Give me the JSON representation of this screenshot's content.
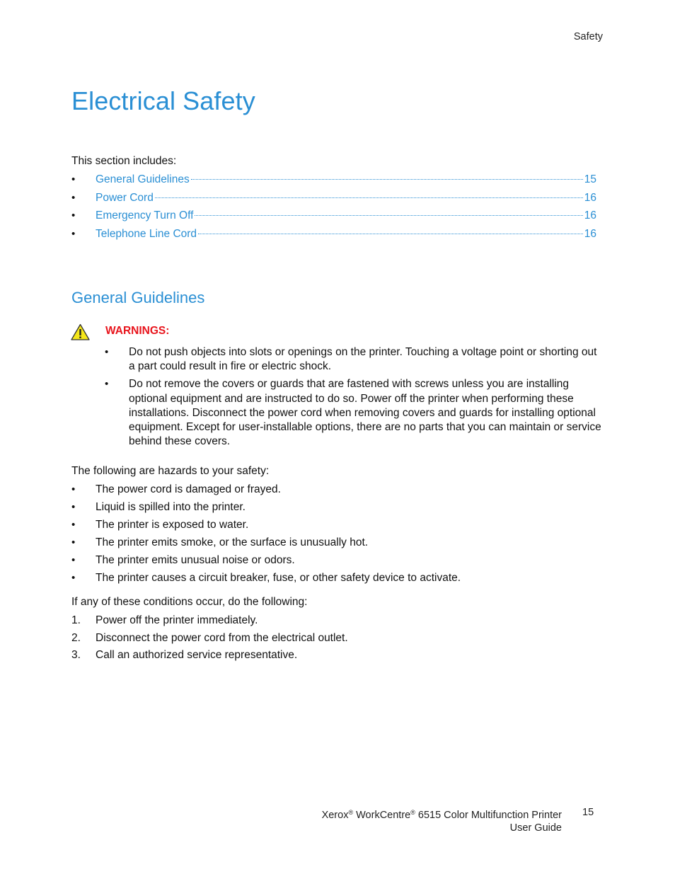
{
  "header": {
    "running_title": "Safety"
  },
  "title": "Electrical Safety",
  "intro": "This section includes:",
  "toc": [
    {
      "label": "General Guidelines",
      "page": "15"
    },
    {
      "label": "Power Cord",
      "page": "16"
    },
    {
      "label": "Emergency Turn Off",
      "page": "16"
    },
    {
      "label": "Telephone Line Cord",
      "page": "16"
    }
  ],
  "section": {
    "heading": "General Guidelines",
    "warning_icon": "warning-triangle-icon",
    "warning_title": "WARNINGS:",
    "warnings": [
      "Do not push objects into slots or openings on the printer. Touching a voltage point or shorting out a part could result in fire or electric shock.",
      "Do not remove the covers or guards that are fastened with screws unless you are installing optional equipment and are instructed to do so. Power off the printer when performing these installations. Disconnect the power cord when removing covers and guards for installing optional equipment. Except for user-installable options, there are no parts that you can maintain or service behind these covers."
    ],
    "hazards_intro": "The following are hazards to your safety:",
    "hazards": [
      "The power cord is damaged or frayed.",
      "Liquid is spilled into the printer.",
      "The printer is exposed to water.",
      "The printer emits smoke, or the surface is unusually hot.",
      "The printer emits unusual noise or odors.",
      "The printer causes a circuit breaker, fuse, or other safety device to activate."
    ],
    "conditions_intro": "If any of these conditions occur, do the following:",
    "steps": [
      {
        "num": "1.",
        "text": "Power off the printer immediately."
      },
      {
        "num": "2.",
        "text": "Disconnect the power cord from the electrical outlet."
      },
      {
        "num": "3.",
        "text": "Call an authorized service representative."
      }
    ]
  },
  "footer": {
    "brand": "Xerox",
    "product": "WorkCentre",
    "model": "6515 Color Multifunction Printer",
    "registered_mark": "®",
    "doc_type": "User Guide",
    "page_number": "15"
  },
  "colors": {
    "heading_blue": "#2a8fd4",
    "warning_red": "#e8141c",
    "warning_yellow": "#f5e61a"
  },
  "bullet_glyph": "•"
}
